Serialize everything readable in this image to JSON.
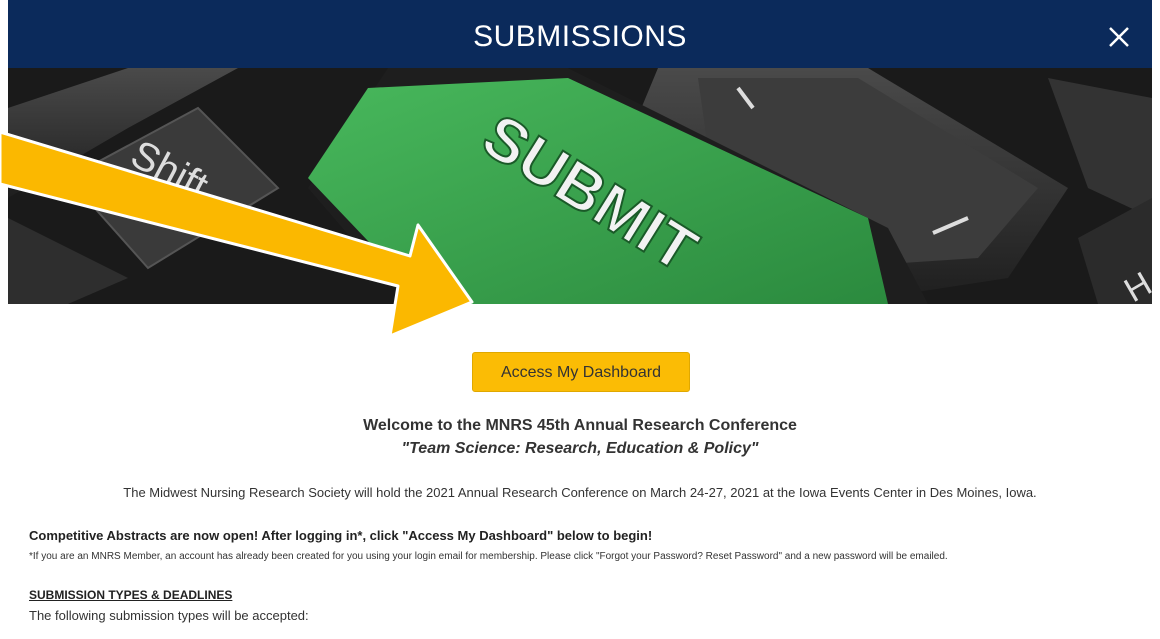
{
  "modal": {
    "title": "SUBMISSIONS",
    "close_icon": "close-x-icon"
  },
  "hero": {
    "key_label": "SUBMIT",
    "side_key_label": "Shift",
    "key_color": "#3aa84f"
  },
  "content": {
    "cta_label": "Access My Dashboard",
    "welcome": "Welcome to the MNRS 45th Annual Research Conference",
    "tagline": "\"Team Science: Research, Education & Policy\"",
    "intro": "The Midwest Nursing Research Society will hold the 2021 Annual Research Conference on March 24-27, 2021 at the Iowa Events Center in Des Moines, Iowa.",
    "notice_heading": "Competitive Abstracts are now open! After logging in*, click \"Access My Dashboard\" below to begin!",
    "notice_small": "*If you are an MNRS Member, an account has already been created for you using your login email for membership. Please click \"Forgot your Password? Reset Password\" and a new password will be emailed.",
    "types_heading": "SUBMISSION TYPES & DEADLINES",
    "types_text": "The following submission types will be accepted:"
  },
  "colors": {
    "header_bg": "#0b2a5b",
    "cta_bg": "#fbbc05",
    "arrow": "#fbb800"
  }
}
